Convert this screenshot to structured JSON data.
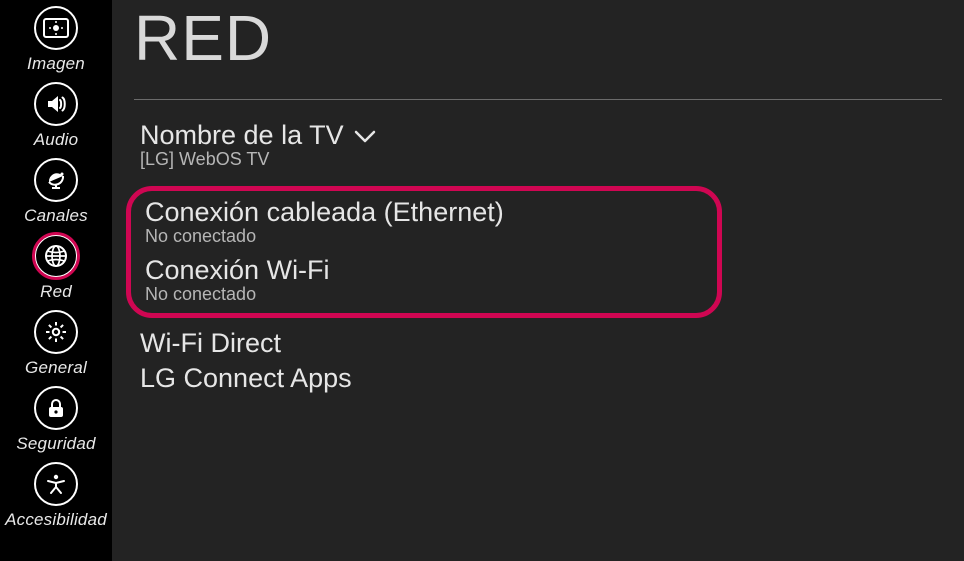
{
  "colors": {
    "accent": "#cf0652"
  },
  "sidebar": {
    "items": [
      {
        "label": "Imagen",
        "icon": "brightness-icon"
      },
      {
        "label": "Audio",
        "icon": "speaker-icon"
      },
      {
        "label": "Canales",
        "icon": "dish-icon"
      },
      {
        "label": "Red",
        "icon": "globe-icon",
        "active": true
      },
      {
        "label": "General",
        "icon": "gear-icon"
      },
      {
        "label": "Seguridad",
        "icon": "lock-icon"
      },
      {
        "label": "Accesibilidad",
        "icon": "accessibility-icon"
      }
    ]
  },
  "page": {
    "title": "RED"
  },
  "settings": {
    "tv_name": {
      "label": "Nombre de la TV",
      "value": "[LG] WebOS TV"
    },
    "ethernet": {
      "label": "Conexión cableada (Ethernet)",
      "status": "No conectado"
    },
    "wifi": {
      "label": "Conexión Wi-Fi",
      "status": "No conectado"
    },
    "wifi_direct": {
      "label": "Wi-Fi Direct"
    },
    "lg_connect": {
      "label": "LG Connect Apps"
    }
  }
}
